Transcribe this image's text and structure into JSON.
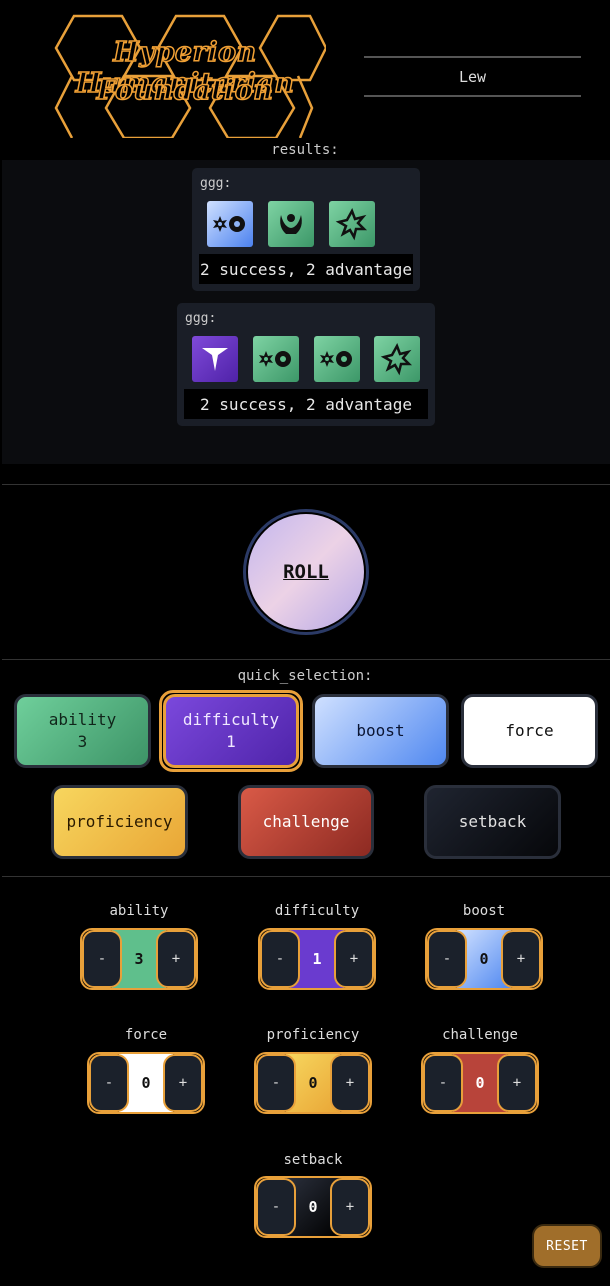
{
  "header": {
    "logo_line1": "Hyperion Humanitarian",
    "logo_line2": "Foundation",
    "username": "Lew"
  },
  "results": {
    "label": "results:",
    "cards": [
      {
        "label": "ggg:",
        "dice": [
          "boost",
          "ability",
          "ability"
        ],
        "summary": "2 success, 2 advantage"
      },
      {
        "label": "ggg:",
        "dice": [
          "difficulty",
          "ability",
          "ability",
          "ability"
        ],
        "summary": "2 success, 2 advantage"
      }
    ]
  },
  "roll": {
    "label": "ROLL"
  },
  "quick_selection": {
    "label": "quick_selection:",
    "items": [
      {
        "name": "ability",
        "count": "3"
      },
      {
        "name": "difficulty",
        "count": "1"
      },
      {
        "name": "boost",
        "count": ""
      },
      {
        "name": "force",
        "count": ""
      },
      {
        "name": "proficiency",
        "count": ""
      },
      {
        "name": "challenge",
        "count": ""
      },
      {
        "name": "setback",
        "count": ""
      }
    ]
  },
  "steppers": [
    {
      "name": "ability",
      "value": "3",
      "color": "#5fbf8c"
    },
    {
      "name": "difficulty",
      "value": "1",
      "color": "#6a3bcf"
    },
    {
      "name": "boost",
      "value": "0",
      "color": "#8fb5f7"
    },
    {
      "name": "force",
      "value": "0",
      "color": "#ffffff"
    },
    {
      "name": "proficiency",
      "value": "0",
      "color": "#f2c04a"
    },
    {
      "name": "challenge",
      "value": "0",
      "color": "#b8443a"
    },
    {
      "name": "setback",
      "value": "0",
      "color": "#000000"
    }
  ],
  "stepper_minus": "-",
  "stepper_plus": "+",
  "reset": {
    "label": "RESET"
  },
  "colors": {
    "accent": "#e8a03a",
    "panel": "#1a1e27"
  }
}
